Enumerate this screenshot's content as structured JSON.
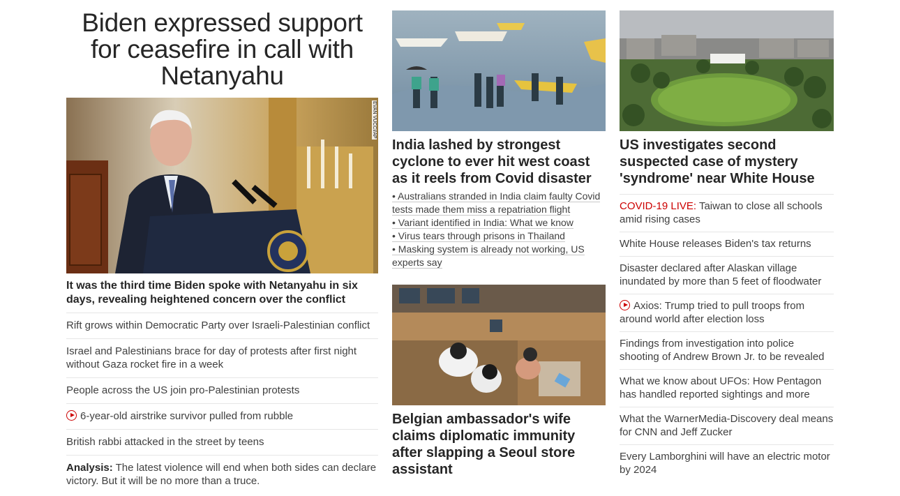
{
  "left": {
    "headline": "Biden expressed support for ceasefire in call with Netanyahu",
    "image_credit": "EVAN VUCCI/AP",
    "caption": "It was the third time Biden spoke with Netanyahu in six days, revealing heightened concern over the conflict",
    "links": [
      {
        "text": "Rift grows within Democratic Party over Israeli-Palestinian conflict"
      },
      {
        "text": "Israel and Palestinians brace for day of protests after first night without Gaza rocket fire in a week"
      },
      {
        "text": "People across the US join pro-Palestinian protests"
      },
      {
        "text": "6-year-old airstrike survivor pulled from rubble",
        "icon": "play-icon"
      },
      {
        "text": "British rabbi attacked in the street by teens"
      },
      {
        "prefix": "Analysis:",
        "text": " The latest violence will end when both sides can declare victory. But it will be no more than a truce."
      }
    ]
  },
  "middle": {
    "story1": {
      "title": "India lashed by strongest cyclone to ever hit west coast as it reels from Covid disaster",
      "bullets": [
        "• Australians stranded in India claim faulty Covid tests made them miss a repatriation flight",
        "• Variant identified in India: What we know",
        "• Virus tears through prisons in Thailand",
        "• Masking system is already not working, US experts say"
      ]
    },
    "story2": {
      "title": "Belgian ambassador's wife claims diplomatic immunity after slapping a Seoul store assistant"
    }
  },
  "right": {
    "title": "US investigates second suspected case of mystery 'syndrome' near White House",
    "links": [
      {
        "live": "COVID-19 LIVE:",
        "text": " Taiwan to close all schools amid rising cases"
      },
      {
        "text": "White House releases Biden's tax returns"
      },
      {
        "text": "Disaster declared after Alaskan village inundated by more than 5 feet of floodwater"
      },
      {
        "text": "Axios: Trump tried to pull troops from around world after election loss",
        "icon": "play-icon"
      },
      {
        "text": "Findings from investigation into police shooting of Andrew Brown Jr. to be revealed"
      },
      {
        "text": "What we know about UFOs: How Pentagon has handled reported sightings and more"
      },
      {
        "text": "What the WarnerMedia-Discovery deal means for CNN and Jeff Zucker"
      },
      {
        "text": "Every Lamborghini will have an electric motor by 2024"
      }
    ]
  },
  "colors": {
    "live_red": "#cc0000",
    "text": "#262626",
    "divider": "#e6e6e6"
  }
}
